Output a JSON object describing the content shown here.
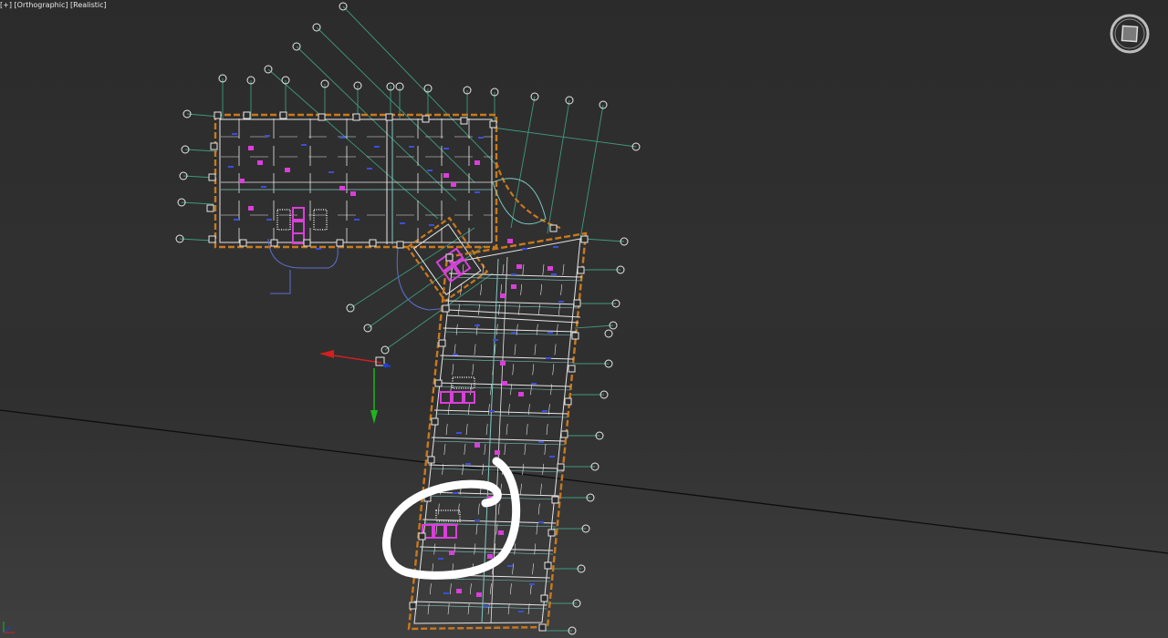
{
  "viewport": {
    "label_parts": [
      "[+]",
      "[Orthographic]",
      "[Realistic]"
    ],
    "view_mode": "Orthographic",
    "shading": "Realistic"
  },
  "colors": {
    "background_top": "#2b2b2b",
    "background_bottom": "#3f3f3f",
    "wall_orange": "#c9791d",
    "grid_line": "#3f9a7f",
    "grid_bubble": "#e8e8e8",
    "inner_white": "#e6e6e6",
    "inner_teal": "#7fc9c2",
    "fixture_magenta": "#d93fd9",
    "label_blue": "#3b4fd8",
    "gizmo_x": "#d21f1f",
    "gizmo_y": "#1fb51f",
    "gizmo_z": "#1f3fd8",
    "annotation": "#ffffff"
  },
  "icons": {
    "viewcube": "viewcube-icon",
    "gizmo": "transform-gizmo-icon",
    "world_axis": "world-axis-icon"
  },
  "annotation": "circle-markup"
}
